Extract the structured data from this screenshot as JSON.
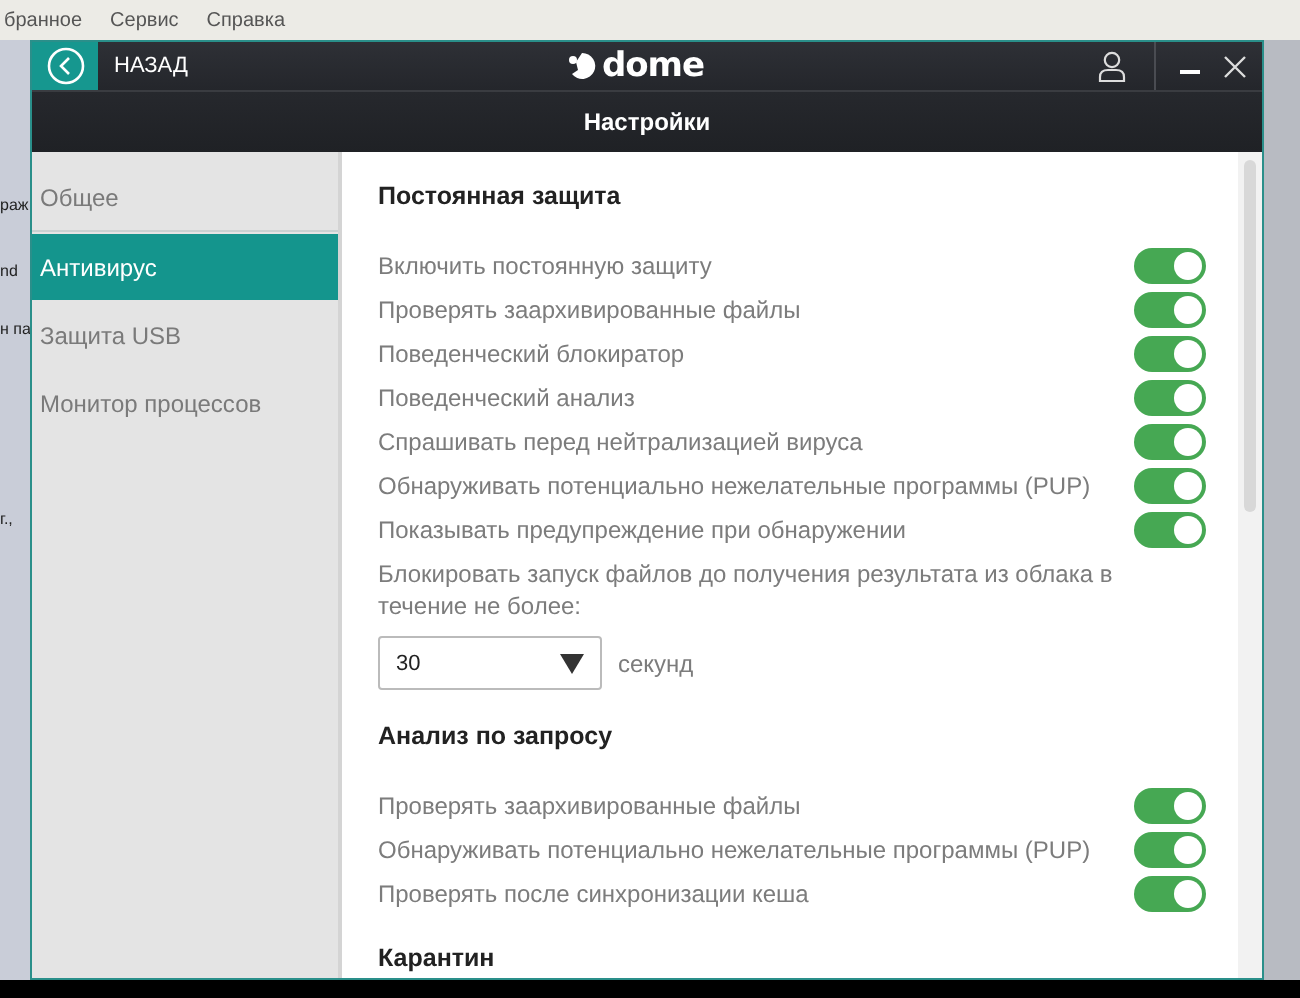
{
  "background_app": {
    "menu": [
      "бранное",
      "Сервис",
      "Справка"
    ],
    "fragments": [
      "раж",
      "nd",
      "н па",
      "г.,"
    ]
  },
  "titlebar": {
    "back_label": "НАЗАД",
    "logo": "dome"
  },
  "header": {
    "title": "Настройки"
  },
  "sidebar": {
    "items": [
      {
        "label": "Общее",
        "selected": false
      },
      {
        "label": "Антивирус",
        "selected": true
      },
      {
        "label": "Защита USB",
        "selected": false
      },
      {
        "label": "Монитор процессов",
        "selected": false
      }
    ]
  },
  "sections": [
    {
      "title": "Постоянная защита",
      "options": [
        {
          "label": "Включить постоянную защиту",
          "on": true
        },
        {
          "label": "Проверять заархивированные файлы",
          "on": true
        },
        {
          "label": "Поведенческий блокиратор",
          "on": true
        },
        {
          "label": "Поведенческий анализ",
          "on": true
        },
        {
          "label": "Спрашивать перед нейтрализацией вируса",
          "on": true
        },
        {
          "label": "Обнаруживать потенциально нежелательные программы (PUP)",
          "on": true
        },
        {
          "label": "Показывать предупреждение при обнаружении",
          "on": true
        }
      ],
      "cloud_block": {
        "text": "Блокировать запуск файлов до получения результата из облака в течение не более:",
        "value": "30",
        "unit": "секунд"
      }
    },
    {
      "title": "Анализ по запросу",
      "options": [
        {
          "label": "Проверять заархивированные файлы",
          "on": true
        },
        {
          "label": "Обнаруживать потенциально нежелательные программы (PUP)",
          "on": true
        },
        {
          "label": "Проверять после синхронизации кеша",
          "on": true
        }
      ]
    },
    {
      "title": "Карантин"
    }
  ]
}
